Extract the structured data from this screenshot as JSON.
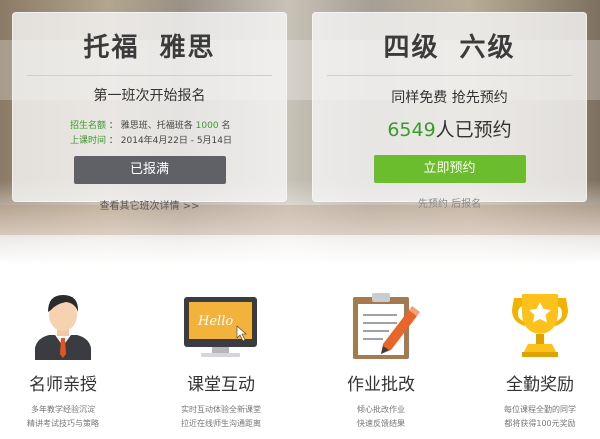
{
  "left_card": {
    "title_a": "托福",
    "title_b": "雅思",
    "subtitle": "第一班次开始报名",
    "enroll_key": "招生名额",
    "enroll_pre": "雅思班、托福班各",
    "enroll_num": "1000",
    "enroll_post": "名",
    "date_key": "上课时间",
    "date_val": "2014年4月22日 - 5月14日",
    "colon": "：",
    "button": "已报满",
    "more_link": "查看其它班次详情 >>"
  },
  "right_card": {
    "title_a": "四级",
    "title_b": "六级",
    "subtitle": "同样免费 抢先预约",
    "count_num": "6549",
    "count_text": "人已预约",
    "button": "立即预约",
    "note": "先预约 后报名"
  },
  "features": [
    {
      "title": "名师亲授",
      "line1": "多年教学经验沉淀",
      "line2": "精讲考试技巧与策略",
      "icon": "teacher-icon"
    },
    {
      "title": "课堂互动",
      "line1": "实时互动体验全新课堂",
      "line2": "拉近在线师生沟通距离",
      "icon": "monitor-hello-icon",
      "screen_text": "Hello"
    },
    {
      "title": "作业批改",
      "line1": "倾心批改作业",
      "line2": "快速反馈结果",
      "icon": "clipboard-pencil-icon"
    },
    {
      "title": "全勤奖励",
      "line1": "每位课程全勤的同学",
      "line2": "都将获得100元奖励",
      "icon": "trophy-icon"
    }
  ],
  "colors": {
    "green": "#6cbd2e",
    "accent_text": "#3a9a2a",
    "gray_button": "#5f6166",
    "title": "#3b3b3b"
  }
}
